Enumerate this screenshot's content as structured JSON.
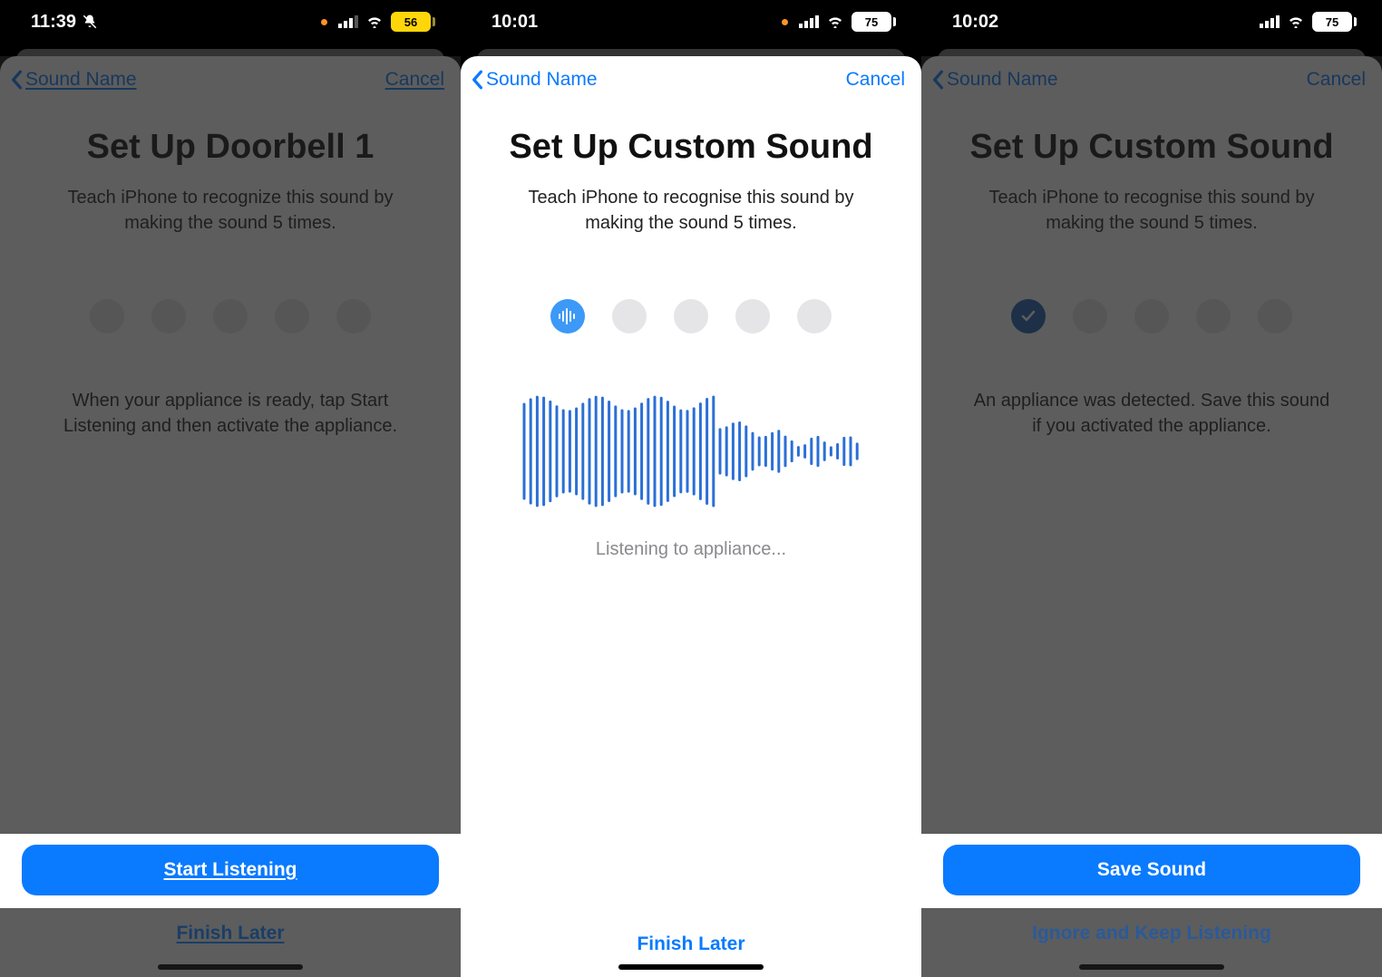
{
  "screens": [
    {
      "status": {
        "time": "11:39",
        "silent": true,
        "battery": "56",
        "battery_style": "yellow"
      },
      "nav": {
        "back": "Sound Name",
        "cancel": "Cancel"
      },
      "title": "Set Up Doorbell 1",
      "subtitle": "Teach iPhone to recognize this sound by making the sound 5 times.",
      "dots": [
        "empty",
        "empty",
        "empty",
        "empty",
        "empty"
      ],
      "message": "When your appliance is ready, tap Start Listening and then activate the appliance.",
      "primary": "Start Listening",
      "secondary": "Finish Later"
    },
    {
      "status": {
        "time": "10:01",
        "silent": false,
        "battery": "75",
        "battery_style": "white"
      },
      "nav": {
        "back": "Sound Name",
        "cancel": "Cancel"
      },
      "title": "Set Up Custom Sound",
      "subtitle": "Teach iPhone to recognise this sound by making the sound 5 times.",
      "dots": [
        "active-wave",
        "empty",
        "empty",
        "empty",
        "empty"
      ],
      "listening_text": "Listening to appliance...",
      "secondary": "Finish Later"
    },
    {
      "status": {
        "time": "10:02",
        "silent": false,
        "battery": "75",
        "battery_style": "white"
      },
      "nav": {
        "back": "Sound Name",
        "cancel": "Cancel"
      },
      "title": "Set Up Custom Sound",
      "subtitle": "Teach iPhone to recognise this sound by making the sound 5 times.",
      "dots": [
        "active-check",
        "empty",
        "empty",
        "empty",
        "empty"
      ],
      "message": "An appliance was detected. Save this sound if you activated the appliance.",
      "primary": "Save Sound",
      "secondary": "Ignore and Keep Listening"
    }
  ]
}
